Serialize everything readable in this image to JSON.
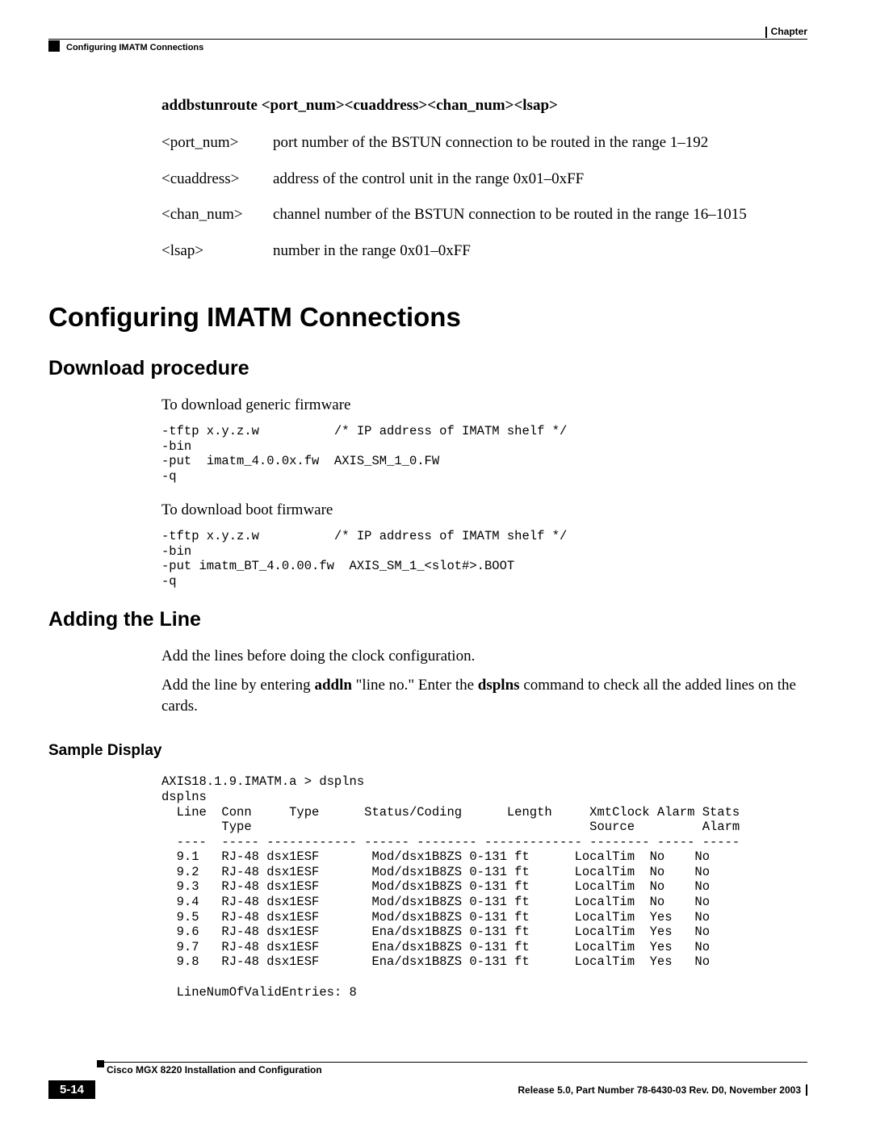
{
  "header": {
    "chapter_label": "Chapter",
    "section_title": "Configuring IMATM Connections"
  },
  "command": {
    "syntax": "addbstunroute <port_num><cuaddress><chan_num><lsap>",
    "params": [
      {
        "name": "<port_num>",
        "desc": "port number of the BSTUN connection to be routed in the range 1–192"
      },
      {
        "name": "<cuaddress>",
        "desc": "address of the control unit in the range 0x01–0xFF"
      },
      {
        "name": "<chan_num>",
        "desc": "channel number of the BSTUN connection to be routed in the range 16–1015"
      },
      {
        "name": "<lsap>",
        "desc": "number in the range 0x01–0xFF"
      }
    ]
  },
  "h1": "Configuring IMATM Connections",
  "download": {
    "title": "Download procedure",
    "intro1": "To download generic firmware",
    "code1": "-tftp x.y.z.w          /* IP address of IMATM shelf */\n-bin\n-put  imatm_4.0.0x.fw  AXIS_SM_1_0.FW\n-q",
    "intro2": "To download boot firmware",
    "code2": "-tftp x.y.z.w          /* IP address of IMATM shelf */\n-bin\n-put imatm_BT_4.0.00.fw  AXIS_SM_1_<slot#>.BOOT\n-q"
  },
  "addline": {
    "title": "Adding the Line",
    "p1": "Add the lines before doing the clock configuration.",
    "p2_pre": "Add the line by entering ",
    "p2_cmd1": "addln",
    "p2_mid": " \"line no.\" Enter the ",
    "p2_cmd2": "dsplns",
    "p2_post": " command to check all the added lines on the cards.",
    "sample_heading": "Sample Display",
    "output": "AXIS18.1.9.IMATM.a > dsplns\ndsplns\n  Line  Conn     Type      Status/Coding      Length     XmtClock Alarm Stats\n        Type                                             Source         Alarm\n  ----  ----- ------------ ------ -------- ------------- -------- ----- -----\n  9.1   RJ-48 dsx1ESF       Mod/dsx1B8ZS 0-131 ft      LocalTim  No    No\n  9.2   RJ-48 dsx1ESF       Mod/dsx1B8ZS 0-131 ft      LocalTim  No    No\n  9.3   RJ-48 dsx1ESF       Mod/dsx1B8ZS 0-131 ft      LocalTim  No    No\n  9.4   RJ-48 dsx1ESF       Mod/dsx1B8ZS 0-131 ft      LocalTim  No    No\n  9.5   RJ-48 dsx1ESF       Mod/dsx1B8ZS 0-131 ft      LocalTim  Yes   No\n  9.6   RJ-48 dsx1ESF       Ena/dsx1B8ZS 0-131 ft      LocalTim  Yes   No\n  9.7   RJ-48 dsx1ESF       Ena/dsx1B8ZS 0-131 ft      LocalTim  Yes   No\n  9.8   RJ-48 dsx1ESF       Ena/dsx1B8ZS 0-131 ft      LocalTim  Yes   No\n\n  LineNumOfValidEntries: 8"
  },
  "footer": {
    "book": "Cisco MGX 8220 Installation and Configuration",
    "pagenum": "5-14",
    "release": "Release 5.0, Part Number 78-6430-03 Rev. D0, November 2003"
  }
}
